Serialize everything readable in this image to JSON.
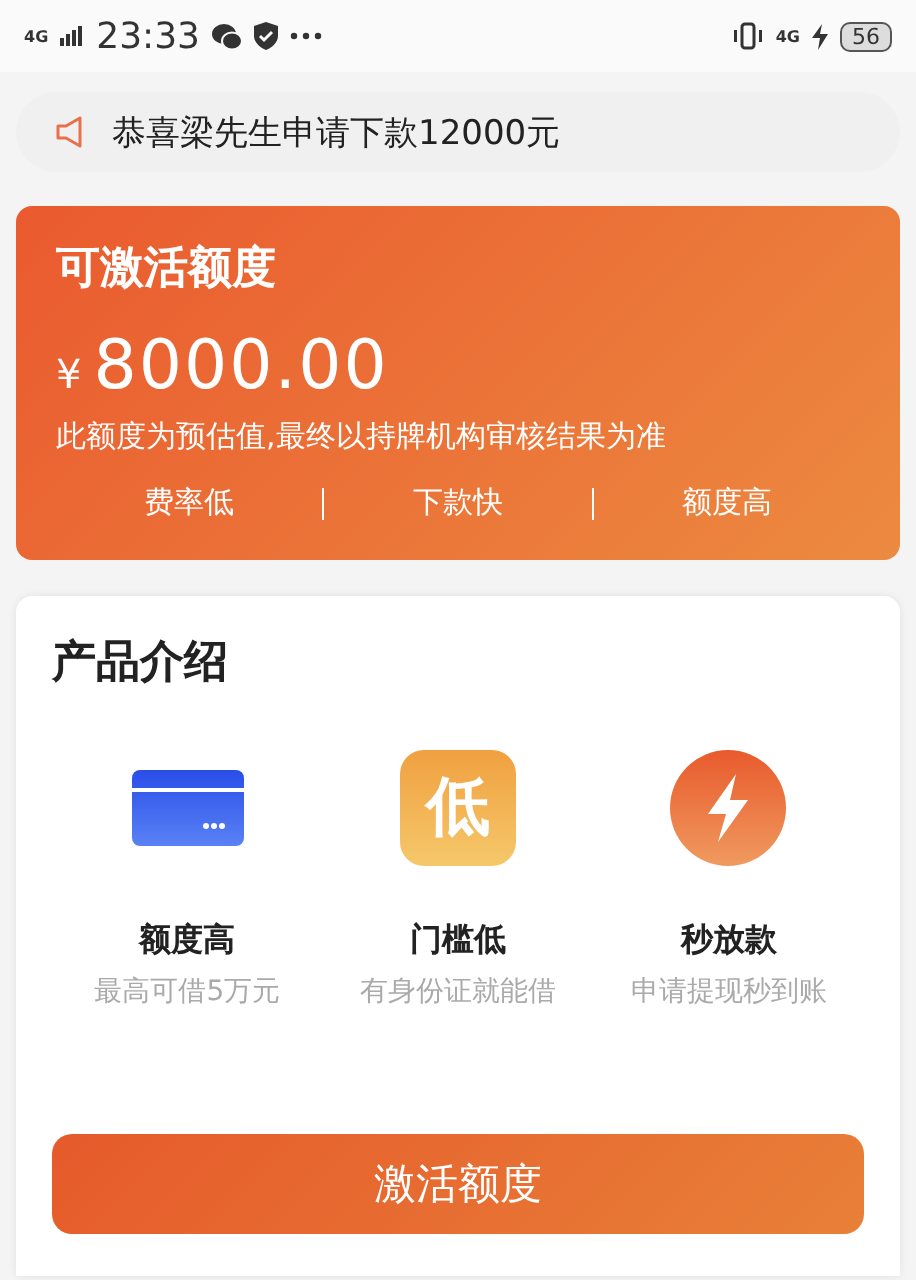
{
  "status_bar": {
    "network_left": "4G",
    "time": "23:33",
    "network_right": "4G",
    "battery": "56"
  },
  "notice": {
    "text": "恭喜梁先生申请下款12000元"
  },
  "quota_card": {
    "title": "可激活额度",
    "currency": "¥",
    "amount": "8000.00",
    "note": "此额度为预估值,最终以持牌机构审核结果为准",
    "tags": [
      "费率低",
      "下款快",
      "额度高"
    ]
  },
  "products": {
    "title": "产品介绍",
    "features": [
      {
        "kind": "card",
        "title": "额度高",
        "subtitle": "最高可借5万元"
      },
      {
        "kind": "badge",
        "badge_text": "低",
        "title": "门槛低",
        "subtitle": "有身份证就能借"
      },
      {
        "kind": "bolt",
        "title": "秒放款",
        "subtitle": "申请提现秒到账"
      }
    ],
    "button": "激活额度"
  }
}
